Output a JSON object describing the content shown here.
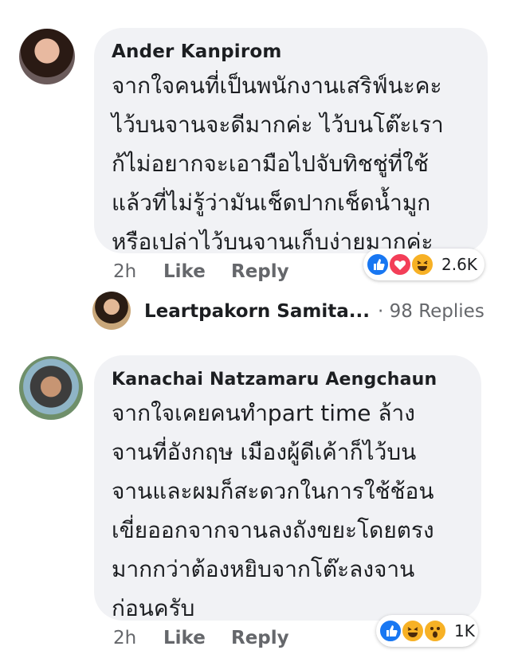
{
  "comments": [
    {
      "author": "Ander Kanpirom",
      "text": "จากใจคนที่เป็นพนักงานเสริฟ์นะคะ\nไว้บนจานจะดีมากค่ะ ไว้บนโต๊ะเรา\nก้ไม่อยากจะเอามือไปจับทิชชู่ที่ใช้\nแล้วที่ไม่รู้ว่ามันเช็ดปากเช็ดน้ำมูก\nหรือเปล่าไว้บนจานเก็บง่ายมากค่ะ",
      "time": "2h",
      "like_label": "Like",
      "reply_label": "Reply",
      "reactions": [
        "like",
        "love",
        "haha"
      ],
      "reaction_count": "2.6K",
      "reply_preview": {
        "name": "Leartpakorn Samita...",
        "count": "· 98 Replies"
      }
    },
    {
      "author": "Kanachai Natzamaru Aengchaun",
      "text": "จากใจเคยคนทำpart time ล้าง\nจานที่อังกฤษ  เมืองผู้ดีเค้าก็ไว้บน\nจานและผมก็สะดวกในการใช้ช้อน\nเขี่ยออกจากจานลงถังขยะโดยตรง\nมากกว่าต้องหยิบจากโต๊ะลงจาน\nก่อนครับ",
      "time": "2h",
      "like_label": "Like",
      "reply_label": "Reply",
      "reactions": [
        "like",
        "haha",
        "wow"
      ],
      "reaction_count": "1K"
    }
  ],
  "colors": {
    "bubble": "#f1f2f5",
    "like": "#1877f2",
    "love": "#f33e58",
    "haha": "#f7b125",
    "meta": "#65676b"
  }
}
